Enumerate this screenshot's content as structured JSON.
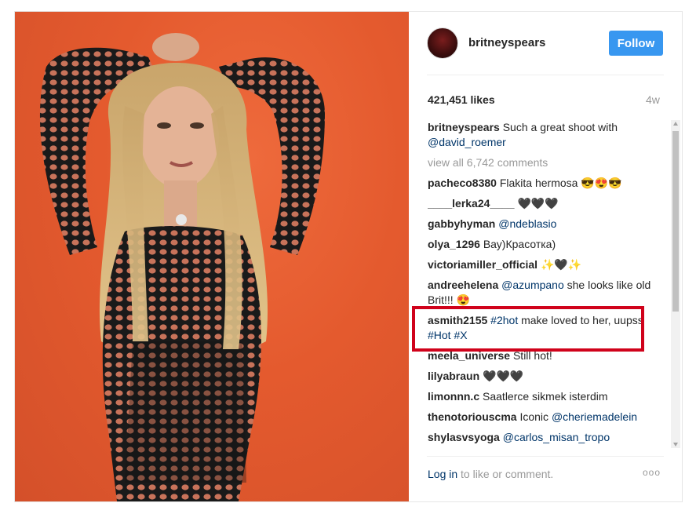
{
  "post": {
    "username": "britneyspears",
    "follow_label": "Follow",
    "likes": "421,451 likes",
    "time": "4w",
    "caption": {
      "user": "britneyspears",
      "text": "Such a great shoot with",
      "mention": "@david_roemer"
    },
    "view_all": "view all 6,742 comments",
    "comments": [
      {
        "user": "pacheco8380",
        "text": "Flakita hermosa",
        "emoji": "😎😍😎"
      },
      {
        "user": "____lerka24____",
        "text": "",
        "emoji": "🖤🖤🖤"
      },
      {
        "user": "gabbyhyman",
        "mention": "@ndeblasio",
        "text": ""
      },
      {
        "user": "olya_1296",
        "text": "Вау)Красотка)"
      },
      {
        "user": "victoriamiller_official",
        "text": "",
        "emoji": "✨🖤✨"
      },
      {
        "user": "andreehelena",
        "mention": "@azumpano",
        "text": "she looks like old Brit!!!",
        "emoji": "😍"
      },
      {
        "user": "asmith2155",
        "tag1": "#2hot",
        "text": "make loved to her, uupss",
        "tag2": "#Hot",
        "tag3": "#X"
      },
      {
        "user": "meela_universe",
        "text": "Still hot!"
      },
      {
        "user": "lilyabraun",
        "text": "",
        "emoji": "🖤🖤🖤"
      },
      {
        "user": "limonnn.c",
        "text": "Saatlerce sikmek isterdim"
      },
      {
        "user": "thenotoriouscma",
        "text": "Iconic",
        "mention": "@cheriemadelein"
      },
      {
        "user": "shylasvsyoga",
        "mention": "@carlos_misan_tropo",
        "text": ""
      }
    ],
    "login_link": "Log in",
    "login_text": "to like or comment.",
    "more_label": "ooo"
  },
  "colors": {
    "accent": "#3897f0",
    "highlight": "#d0021b",
    "photo_background": "#e45a2e"
  }
}
